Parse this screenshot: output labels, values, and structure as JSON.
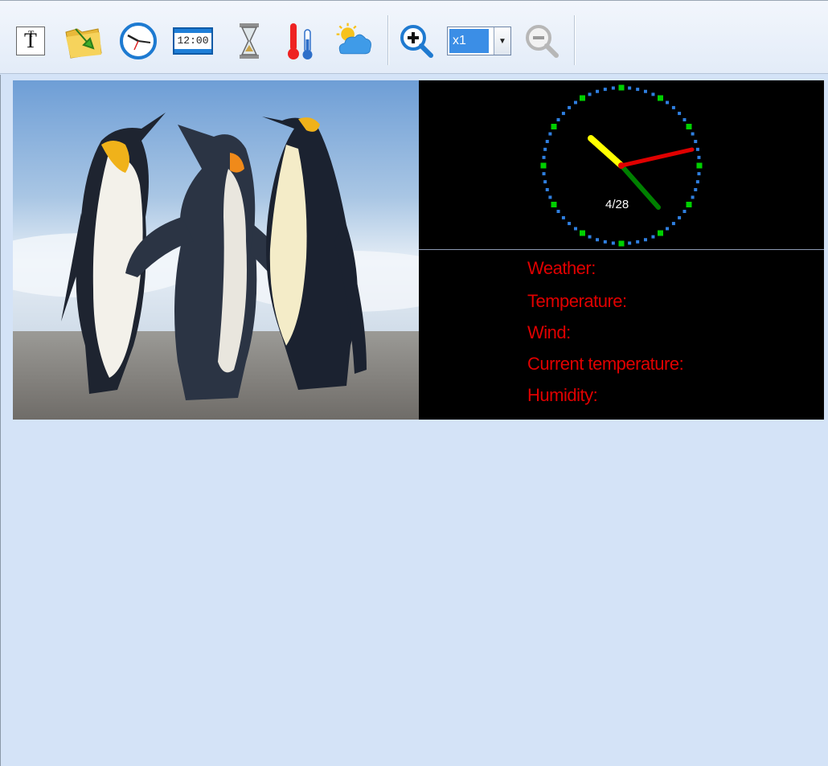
{
  "toolbar": {
    "buttons": [
      {
        "name": "text-tool",
        "icon": "text-icon"
      },
      {
        "name": "open-folder",
        "icon": "folder-icon"
      },
      {
        "name": "analog-clock",
        "icon": "clock-icon"
      },
      {
        "name": "digital-clock",
        "icon": "digital-clock-icon",
        "label": "12:00"
      },
      {
        "name": "timer",
        "icon": "hourglass-icon"
      },
      {
        "name": "temperature",
        "icon": "thermometer-icon"
      },
      {
        "name": "weather",
        "icon": "weather-icon"
      },
      {
        "name": "zoom-in",
        "icon": "zoom-in-icon"
      },
      {
        "name": "zoom-out",
        "icon": "zoom-out-icon"
      }
    ],
    "zoom_value": "x1"
  },
  "clock": {
    "date": "4/28",
    "colors": {
      "face_dots": "#2f7fe0",
      "hour_marks": "#00d000",
      "hour_hand": "#ffff00",
      "minute_hand": "#e00000",
      "second_hand": "#008000"
    }
  },
  "weather": {
    "labels": [
      "Weather:",
      "Temperature:",
      "Wind:",
      "Current temperature:",
      "Humidity:"
    ],
    "text_color": "#e00000"
  }
}
